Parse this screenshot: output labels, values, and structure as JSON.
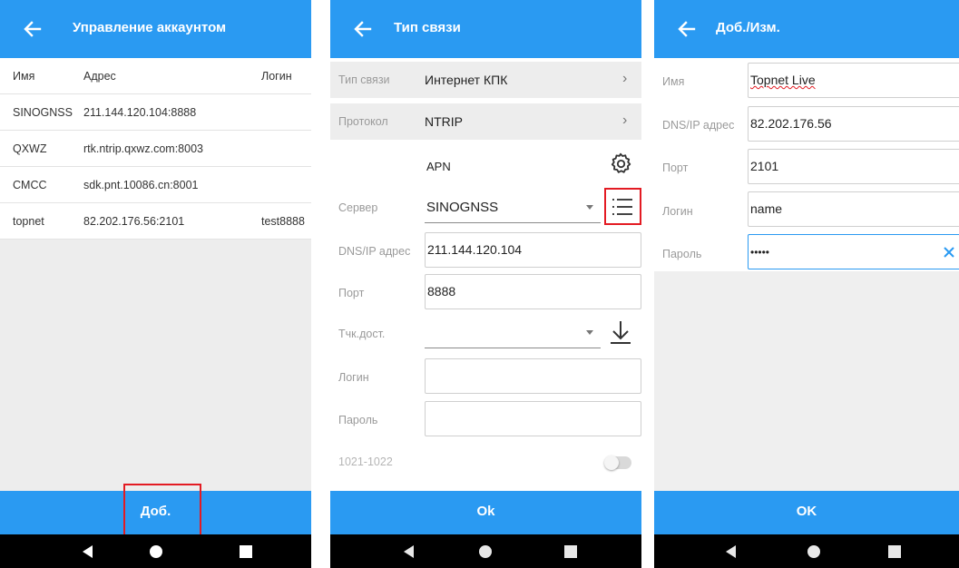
{
  "account_screen": {
    "title": "Управление аккаунтом",
    "columns": [
      "Имя",
      "Адрес",
      "Логин"
    ],
    "rows": [
      {
        "name": "SINOGNSS",
        "address": "211.144.120.104:8888",
        "login": ""
      },
      {
        "name": "QXWZ",
        "address": "rtk.ntrip.qxwz.com:8003",
        "login": ""
      },
      {
        "name": "CMCC",
        "address": "sdk.pnt.10086.cn:8001",
        "login": ""
      },
      {
        "name": "topnet",
        "address": "82.202.176.56:2101",
        "login": "test8888"
      }
    ],
    "add_label": "Доб."
  },
  "connection_screen": {
    "title": "Тип связи",
    "conn_type_label": "Тип связи",
    "conn_type_value": "Интернет КПК",
    "protocol_label": "Протокол",
    "protocol_value": "NTRIP",
    "apn_label": "APN",
    "server_label": "Сервер",
    "server_value": "SINOGNSS",
    "dns_label": "DNS/IP адрес",
    "dns_value": "211.144.120.104",
    "port_label": "Порт",
    "port_value": "8888",
    "mountpoint_label": "Тчк.дост.",
    "mountpoint_value": "",
    "login_label": "Логин",
    "login_value": "",
    "password_label": "Пароль",
    "password_value": "",
    "rtcm_label": "1021-1022",
    "rtcm_enabled": false,
    "ok_label": "Ok"
  },
  "edit_screen": {
    "title": "Доб./Изм.",
    "name_label": "Имя",
    "name_value": "Topnet Live",
    "dns_label": "DNS/IP адрес",
    "dns_value": "82.202.176.56",
    "port_label": "Порт",
    "port_value": "2101",
    "login_label": "Логин",
    "login_value": "name",
    "password_label": "Пароль",
    "password_value": "•••••",
    "ok_label": "OK"
  },
  "colors": {
    "accent": "#2a9af2",
    "highlight": "#e31b23",
    "navbar": "#000000"
  },
  "icons": {
    "back": "arrow-left-icon",
    "settings": "gear-icon",
    "account_list": "list-icon",
    "download": "download-icon",
    "clear": "close-icon",
    "nav_back": "triangle-back-icon",
    "nav_home": "circle-home-icon",
    "nav_recents": "square-recents-icon"
  }
}
